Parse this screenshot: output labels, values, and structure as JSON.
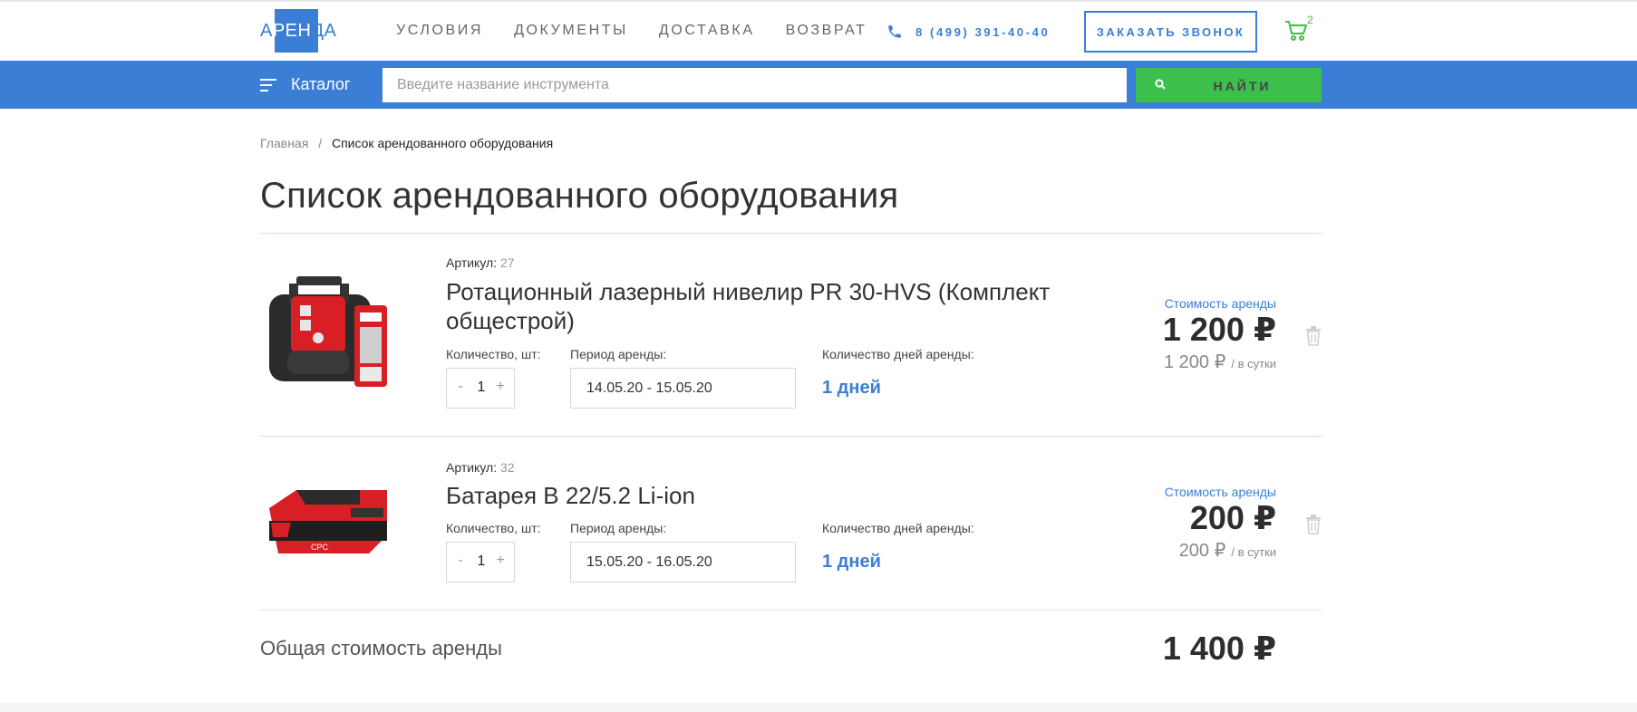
{
  "header": {
    "logo": "АРЕНДА",
    "nav": [
      "УСЛОВИЯ",
      "ДОКУМЕНТЫ",
      "ДОСТАВКА",
      "ВОЗВРАТ"
    ],
    "phone": "8 (499) 391-40-40",
    "callback_label": "ЗАКАЗАТЬ ЗВОНОК",
    "cart_count": "2"
  },
  "search_bar": {
    "catalog_label": "Каталог",
    "placeholder": "Введите название инструмента",
    "find_label": "НАЙТИ"
  },
  "breadcrumb": {
    "home": "Главная",
    "separator": "/",
    "current": "Список арендованного оборудования"
  },
  "page_title": "Список арендованного оборудования",
  "labels": {
    "article": "Артикул:",
    "quantity": "Количество, шт:",
    "period": "Период аренды:",
    "days": "Количество дней аренды:",
    "cost": "Стоимость аренды",
    "per_day": "/ в сутки",
    "minus": "-",
    "plus": "+"
  },
  "items": [
    {
      "article": "27",
      "name": "Ротационный лазерный нивелир PR 30-HVS (Комплект общестрой)",
      "quantity": "1",
      "period": "14.05.20 - 15.05.20",
      "days": "1 дней",
      "price": "1 200 ₽",
      "day_price": "1 200 ₽"
    },
    {
      "article": "32",
      "name": "Батарея B 22/5.2 Li-ion",
      "quantity": "1",
      "period": "15.05.20 - 16.05.20",
      "days": "1 дней",
      "price": "200 ₽",
      "day_price": "200 ₽"
    }
  ],
  "total": {
    "label": "Общая стоимость аренды",
    "value": "1 400 ₽"
  },
  "colors": {
    "brand_blue": "#3a7fd5",
    "accent_green": "#3cbf4c"
  }
}
